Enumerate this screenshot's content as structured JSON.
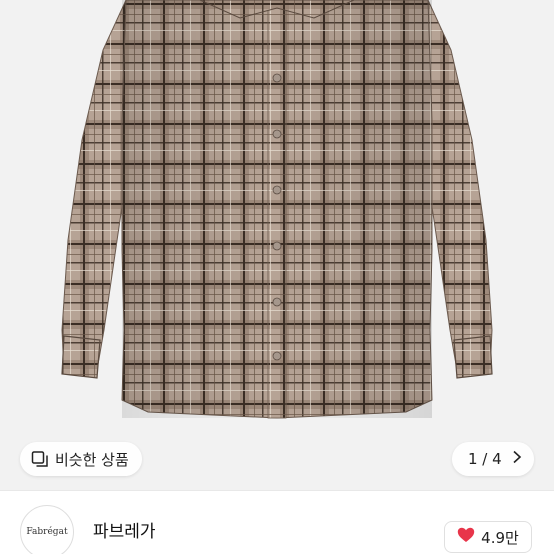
{
  "gallery": {
    "similar_label": "비슷한 상품",
    "pager": {
      "current": 1,
      "total": 4,
      "label": "1 / 4"
    }
  },
  "seller": {
    "logo_text": "Fabrégat",
    "name": "파브레가",
    "likes": "4.9만"
  },
  "icons": {
    "similar": "similar-products-icon",
    "next": "chevron-right-icon",
    "heart": "heart-icon"
  },
  "colors": {
    "heart": "#e8354a",
    "shirt_base": "#b8a596",
    "shirt_line": "#3e3128"
  }
}
